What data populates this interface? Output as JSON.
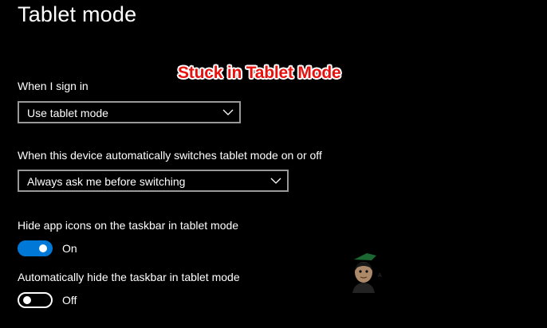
{
  "page": {
    "title": "Tablet mode"
  },
  "overlay": {
    "caption": "Stuck in Tablet Mode",
    "caption_color": "#e8100c"
  },
  "sign_in": {
    "label": "When I sign in",
    "selected": "Use tablet mode"
  },
  "auto_switch": {
    "label": "When this device automatically switches tablet mode on or off",
    "selected": "Always ask me before switching"
  },
  "hide_app_icons": {
    "label": "Hide app icons on the taskbar in tablet mode",
    "state": "On",
    "enabled": true
  },
  "auto_hide_taskbar": {
    "label": "Automatically hide the taskbar in tablet mode",
    "state": "Off",
    "enabled": false
  },
  "colors": {
    "background": "#000000",
    "accent": "#0078d7",
    "text": "#ffffff",
    "dropdown_border": "#999999"
  },
  "icons": {
    "dropdown": "chevron-down-icon",
    "watermark": "appuals-mascot-logo"
  }
}
